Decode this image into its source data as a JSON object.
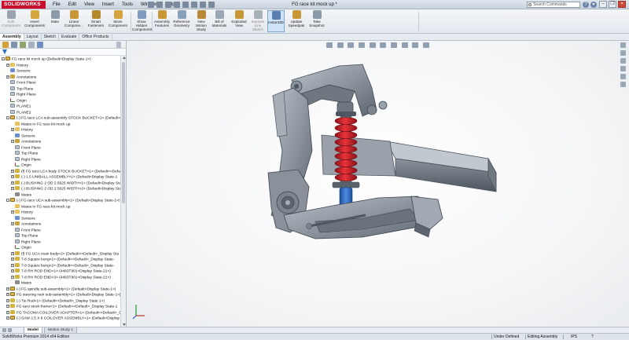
{
  "app": {
    "brand": "SOLIDWORKS",
    "window_title": "FG race kit mock up *",
    "menus": [
      "File",
      "Edit",
      "View",
      "Insert",
      "Tools",
      "Window",
      "Help"
    ],
    "search_placeholder": "Search Commands"
  },
  "ribbon": {
    "buttons": [
      {
        "label": "Edit Component",
        "dim": true,
        "icon_color": "#9aa4ae"
      },
      {
        "label": "Insert Components",
        "dim": false,
        "icon_color": "#d4a640"
      },
      {
        "label": "Mate",
        "dim": false,
        "icon_color": "#8a9aa9"
      },
      {
        "label": "Linear Compone...",
        "dim": false,
        "icon_color": "#c89838"
      },
      {
        "label": "Smart Fasteners",
        "dim": false,
        "icon_color": "#b38a2c"
      },
      {
        "label": "Move Component",
        "dim": false,
        "icon_color": "#d4a640"
      },
      {
        "label": "Show Hidden Components",
        "dim": false,
        "icon_color": "#7f9bbf"
      },
      {
        "label": "Assembly Features",
        "dim": false,
        "icon_color": "#c89838"
      },
      {
        "label": "Reference Geometry",
        "dim": false,
        "icon_color": "#8aa0b8"
      },
      {
        "label": "New Motion Study",
        "dim": false,
        "icon_color": "#b9893a"
      },
      {
        "label": "Bill of Materials",
        "dim": false,
        "icon_color": "#9aa8b6"
      },
      {
        "label": "Exploded View",
        "dim": false,
        "icon_color": "#c89838"
      },
      {
        "label": "Explode Line Sketch",
        "dim": true,
        "icon_color": "#a8b0b8"
      },
      {
        "label": "Instant3D",
        "dim": false,
        "icon_color": "#5a7fb0",
        "selected": true
      },
      {
        "label": "Update Speedpak",
        "dim": false,
        "icon_color": "#c89838"
      },
      {
        "label": "Take Snapshot",
        "dim": false,
        "icon_color": "#8a9aa9"
      }
    ]
  },
  "command_tabs": [
    "Assembly",
    "Layout",
    "Sketch",
    "Evaluate",
    "Office Products"
  ],
  "tree": [
    {
      "d": 0,
      "exp": "-",
      "icon": "asm",
      "text": "FG race kit mock up  (Default<Display State-1>)"
    },
    {
      "d": 1,
      "exp": "+",
      "icon": "folder",
      "text": "History"
    },
    {
      "d": 1,
      "exp": "",
      "icon": "sensor",
      "text": "Sensors"
    },
    {
      "d": 1,
      "exp": "+",
      "icon": "annot",
      "text": "Annotations"
    },
    {
      "d": 1,
      "exp": "",
      "icon": "plane",
      "text": "Front Plane"
    },
    {
      "d": 1,
      "exp": "",
      "icon": "plane",
      "text": "Top Plane"
    },
    {
      "d": 1,
      "exp": "",
      "icon": "plane",
      "text": "Right Plane"
    },
    {
      "d": 1,
      "exp": "",
      "icon": "origin",
      "text": "Origin"
    },
    {
      "d": 1,
      "exp": "",
      "icon": "plane",
      "text": "PLANE1"
    },
    {
      "d": 1,
      "exp": "",
      "icon": "plane",
      "text": "PLANE2"
    },
    {
      "d": 1,
      "exp": "-",
      "icon": "asm",
      "text": "(-) FG taco LCA sub-assembly STOCK BUCKET<1> (Default<D"
    },
    {
      "d": 2,
      "exp": "",
      "icon": "folder",
      "text": "Mates in FG race kit mock up"
    },
    {
      "d": 2,
      "exp": "+",
      "icon": "folder",
      "text": "History"
    },
    {
      "d": 2,
      "exp": "",
      "icon": "sensor",
      "text": "Sensors"
    },
    {
      "d": 2,
      "exp": "+",
      "icon": "annot",
      "text": "Annotations"
    },
    {
      "d": 2,
      "exp": "",
      "icon": "plane",
      "text": "Front Plane"
    },
    {
      "d": 2,
      "exp": "",
      "icon": "plane",
      "text": "Top Plane"
    },
    {
      "d": 2,
      "exp": "",
      "icon": "plane",
      "text": "Right Plane"
    },
    {
      "d": 2,
      "exp": "",
      "icon": "origin",
      "text": "Origin"
    },
    {
      "d": 2,
      "exp": "+",
      "icon": "part",
      "text": "(f) FG taco LCA body STOCK BUCKET<1> (Default<<Default"
    },
    {
      "d": 2,
      "exp": "+",
      "icon": "part",
      "text": "(-) 1.5 UNIBALL ASSEMBLY<1> (Default<Display State-1"
    },
    {
      "d": 2,
      "exp": "+",
      "icon": "part",
      "text": "(-) BUSHING 2 OD 2.5625 WIDTH<1> (Default<Display Sta"
    },
    {
      "d": 2,
      "exp": "+",
      "icon": "part",
      "text": "(-) BUSHING 2 OD 2.5625 WIDTH<2> (Default<Display Sta"
    },
    {
      "d": 2,
      "exp": "",
      "icon": "mates",
      "text": "Mates"
    },
    {
      "d": 1,
      "exp": "-",
      "icon": "asm",
      "text": "(-) FG taco UCA sub-assembly<1> (Default<Display State-1>)"
    },
    {
      "d": 2,
      "exp": "",
      "icon": "folder",
      "text": "Mates in FG race kit mock up"
    },
    {
      "d": 2,
      "exp": "+",
      "icon": "folder",
      "text": "History"
    },
    {
      "d": 2,
      "exp": "",
      "icon": "sensor",
      "text": "Sensors"
    },
    {
      "d": 2,
      "exp": "+",
      "icon": "annot",
      "text": "Annotations"
    },
    {
      "d": 2,
      "exp": "",
      "icon": "plane",
      "text": "Front Plane"
    },
    {
      "d": 2,
      "exp": "",
      "icon": "plane",
      "text": "Top Plane"
    },
    {
      "d": 2,
      "exp": "",
      "icon": "plane",
      "text": "Right Plane"
    },
    {
      "d": 2,
      "exp": "",
      "icon": "origin",
      "text": "Origin"
    },
    {
      "d": 2,
      "exp": "+",
      "icon": "part",
      "text": "(f) FG UCA main body<2> (Default<<Default>_Display Sta"
    },
    {
      "d": 2,
      "exp": "+",
      "icon": "part",
      "text": "7-8 Square bung<1> (Default<<Default>_Display State-"
    },
    {
      "d": 2,
      "exp": "+",
      "icon": "part",
      "text": "7-8 Square bung<2> (Default<<Default>_Display State-"
    },
    {
      "d": 2,
      "exp": "+",
      "icon": "part",
      "text": "7-8 RH ROD END<1> (4483T901<Display State-21>)"
    },
    {
      "d": 2,
      "exp": "+",
      "icon": "part",
      "text": "7-8 RH ROD END<3> (4483T901<Display State-21>)"
    },
    {
      "d": 2,
      "exp": "",
      "icon": "mates",
      "text": "Mates"
    },
    {
      "d": 1,
      "exp": "+",
      "icon": "asm",
      "text": "(-) FG spindle sub-assembly<1> (Default<Display State-1>)"
    },
    {
      "d": 1,
      "exp": "+",
      "icon": "asm",
      "text": "FG steering rack sub-assembly<1> (Default<Display State-1>)"
    },
    {
      "d": 1,
      "exp": "+",
      "icon": "part",
      "text": "(-) Tie Rod<1> (Default<<Default>_Display State 1>)"
    },
    {
      "d": 1,
      "exp": "+",
      "icon": "part",
      "text": "FG taco stock frame<1> (Default<<Default>_Display State-1"
    },
    {
      "d": 1,
      "exp": "+",
      "icon": "part",
      "text": "FG TACOMA COILOVER ADAPTER<1> (Default<<Default>_D"
    },
    {
      "d": 1,
      "exp": "+",
      "icon": "asm",
      "text": "(-) SAW 2.5 X 8 COILOVER ASSEMBLY<1> (Default<Display St"
    }
  ],
  "bottom_tabs": [
    "Model",
    "Motion Study 1"
  ],
  "status": {
    "edition": "SolidWorks Premium 2014 x64 Edition",
    "definition": "Under Defined",
    "mode": "Editing Assembly",
    "units": "IPS"
  },
  "colors": {
    "model_gray": "#8e959f",
    "model_dark": "#5d6570",
    "coil_red": "#d9222a",
    "shock_blue": "#2f6fc9"
  }
}
